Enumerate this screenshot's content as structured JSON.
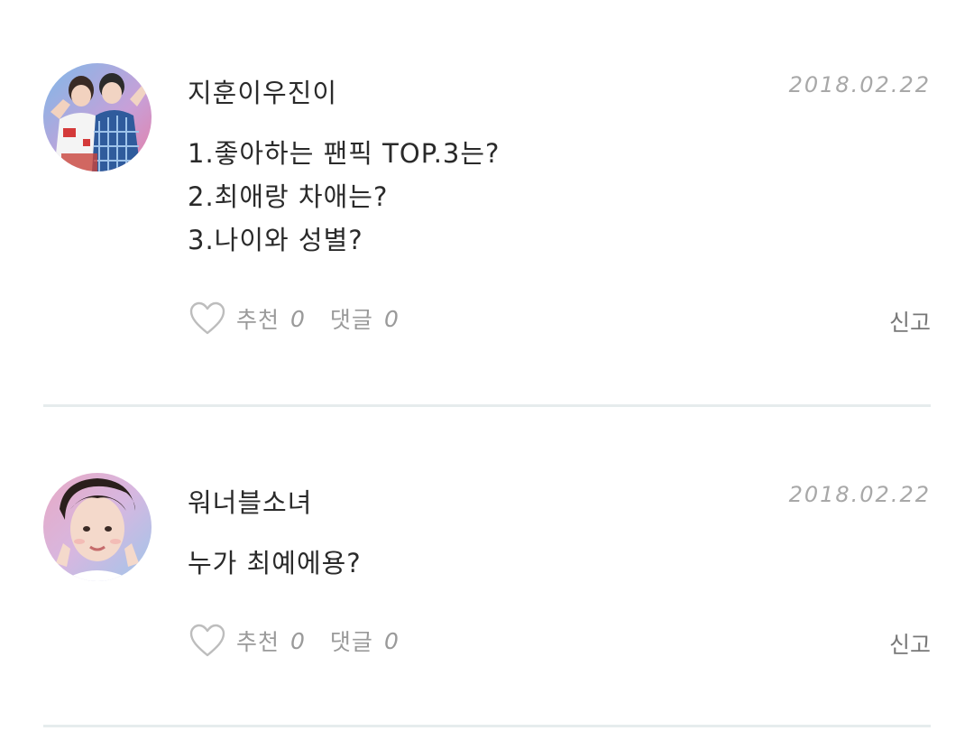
{
  "posts": [
    {
      "username": "지훈이우진이",
      "date": "2018.02.22",
      "lines": [
        "1.좋아하는 팬픽 TOP.3는?",
        "2.최애랑 차애는?",
        "3.나이와 성별?"
      ],
      "like_label": "추천",
      "like_count": "0",
      "comment_label": "댓글",
      "comment_count": "0",
      "report_label": "신고"
    },
    {
      "username": "워너블소녀",
      "date": "2018.02.22",
      "lines": [
        "누가 최예에용?"
      ],
      "like_label": "추천",
      "like_count": "0",
      "comment_label": "댓글",
      "comment_count": "0",
      "report_label": "신고"
    }
  ],
  "colors": {
    "text": "#2a2a2a",
    "muted": "#9a9a9a",
    "date": "#a8a8a8",
    "divider": "#e6eced",
    "heart": "#bdbdbd"
  },
  "icons": {
    "like": "heart-outline-icon"
  }
}
